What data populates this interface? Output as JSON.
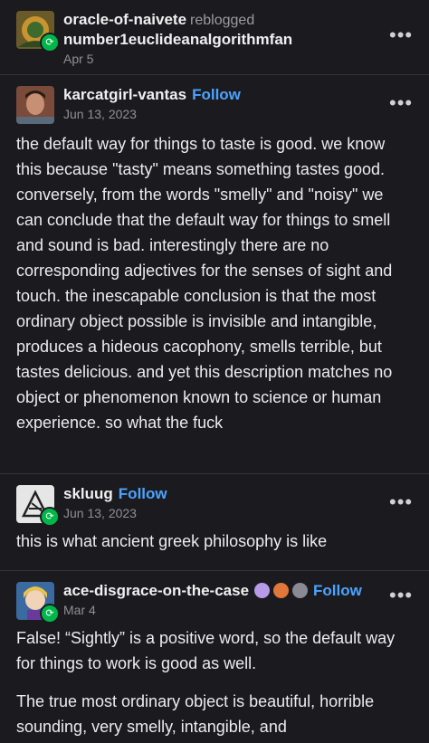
{
  "header": {
    "reblogger": "oracle-of-naivete",
    "action": "reblogged",
    "source": "number1euclideanalgorithmfan",
    "date": "Apr 5"
  },
  "posts": [
    {
      "username": "karcatgirl-vantas",
      "follow": "Follow",
      "date": "Jun 13, 2023",
      "paragraphs": [
        "the default way for things to taste is good.  we know this because \"tasty\" means something tastes good.  conversely, from the words \"smelly\" and \"noisy\" we can conclude that the default way for things to smell and sound is bad.  interestingly there are no corresponding adjectives for the senses of sight and touch.  the inescapable conclusion is that the most ordinary object possible is invisible and intangible, produces a hideous cacophony, smells terrible, but tastes delicious.  and yet this description matches no object or phenomenon known to science or human experience.  so what the fuck"
      ]
    },
    {
      "username": "skluug",
      "follow": "Follow",
      "date": "Jun 13, 2023",
      "paragraphs": [
        "this is what ancient greek philosophy is like"
      ]
    },
    {
      "username": "ace-disgrace-on-the-case",
      "follow": "Follow",
      "date": "Mar 4",
      "badge_icons": [
        "brain-badge-icon",
        "cookie-badge-icon",
        "mask-badge-icon"
      ],
      "paragraphs": [
        "False! “Sightly” is a positive word, so the default way for things to work is good as well.",
        "The true most ordinary object is beautiful, horrible sounding, very smelly, intangible, and"
      ]
    }
  ],
  "icons": {
    "more": "more-options-icon",
    "reblog": "reblog-icon"
  },
  "colors": {
    "background": "#1b1b1f",
    "follow": "#4ba3ff",
    "reblog_badge": "#00b84a"
  }
}
